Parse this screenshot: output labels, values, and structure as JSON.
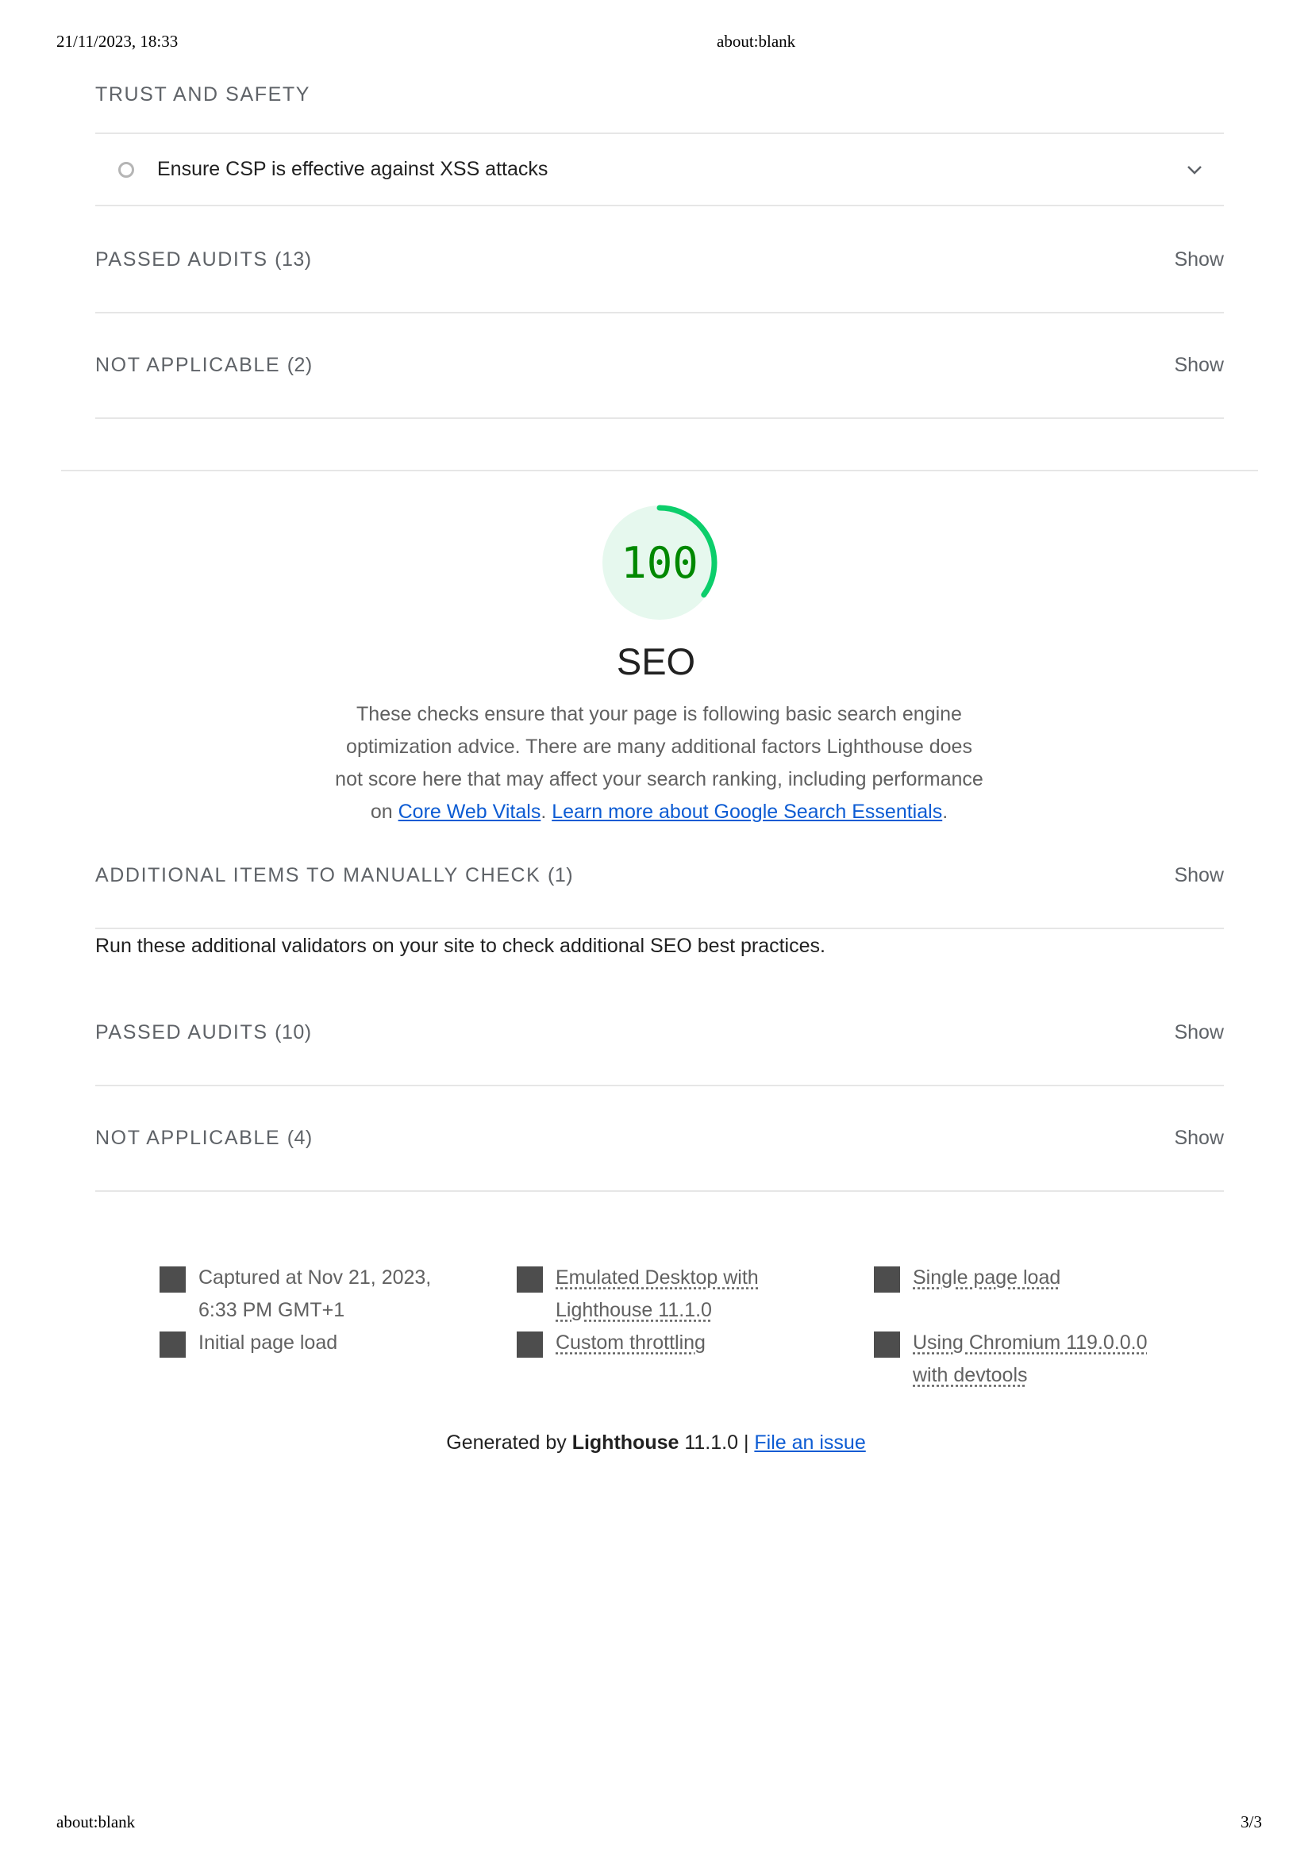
{
  "print_header": {
    "datetime": "21/11/2023, 18:33",
    "url": "about:blank"
  },
  "print_footer": {
    "url": "about:blank",
    "page": "3/3"
  },
  "best_practices": {
    "trust_and_safety": {
      "title": "TRUST AND SAFETY",
      "audit_title": "Ensure CSP is effective against XSS attacks"
    },
    "passed_audits": {
      "title": "PASSED AUDITS",
      "count": "(13)",
      "toggle": "Show"
    },
    "not_applicable": {
      "title": "NOT APPLICABLE",
      "count": "(2)",
      "toggle": "Show"
    }
  },
  "seo": {
    "score": "100",
    "score_fraction": 1.0,
    "score_color": "#0cce6b",
    "title": "SEO",
    "description_text": "These checks ensure that your page is following basic search engine optimization advice. There are many additional factors Lighthouse does not score here that may affect your search ranking, including performance on ",
    "link_core_web_vitals": "Core Web Vitals",
    "separator": ". ",
    "link_learn_more": "Learn more about Google Search Essentials",
    "end_period": ".",
    "manual_check": {
      "title": "ADDITIONAL ITEMS TO MANUALLY CHECK",
      "count": "(1)",
      "toggle": "Show",
      "description": "Run these additional validators on your site to check additional SEO best practices."
    },
    "passed_audits": {
      "title": "PASSED AUDITS",
      "count": "(10)",
      "toggle": "Show"
    },
    "not_applicable": {
      "title": "NOT APPLICABLE",
      "count": "(4)",
      "toggle": "Show"
    }
  },
  "environment": {
    "captured": "Captured at Nov 21, 2023, 6:33 PM GMT+1",
    "initial_load": "Initial page load",
    "emulated": "Emulated Desktop with Lighthouse 11.1.0",
    "throttling": "Custom throttling",
    "single_load": "Single page load",
    "chromium": "Using Chromium 119.0.0.0 with devtools"
  },
  "footer": {
    "generated_by": "Generated by ",
    "product": "Lighthouse",
    "version": " 11.1.0 | ",
    "issue_link": "File an issue"
  }
}
